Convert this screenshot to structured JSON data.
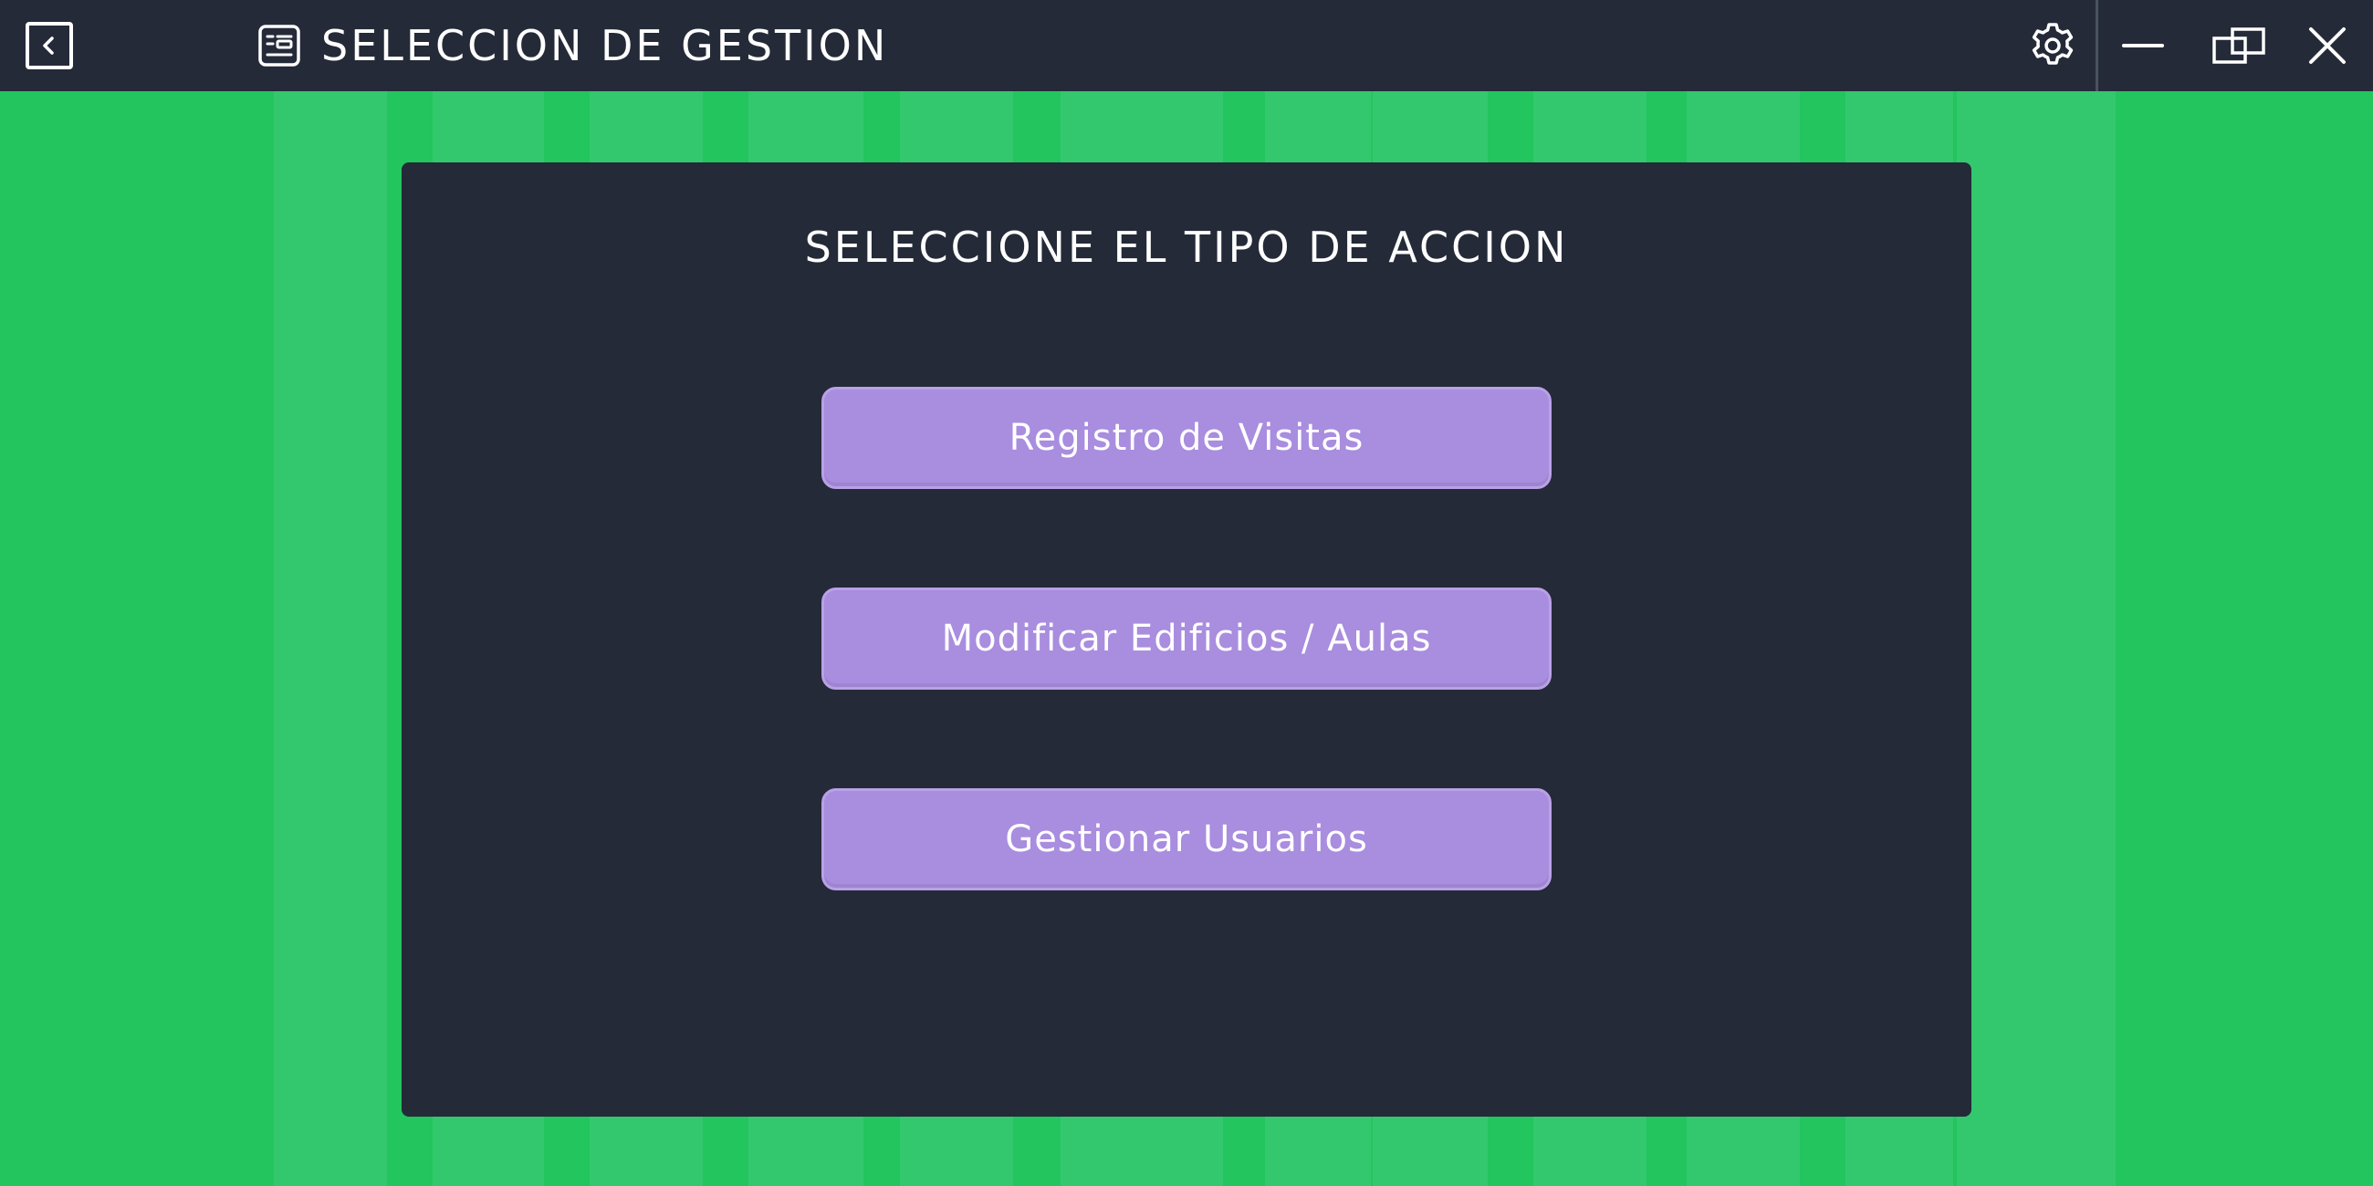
{
  "window": {
    "title": "SELECCION DE GESTION",
    "controls": {
      "back_icon": "chevron-left-icon",
      "app_icon": "form-list-icon",
      "settings_icon": "gear-icon",
      "minimize_icon": "minimize-icon",
      "restore_icon": "restore-icon",
      "close_icon": "close-icon"
    }
  },
  "card": {
    "title": "SELECCIONE EL TIPO DE ACCION",
    "buttons": [
      {
        "label": "Registro de Visitas"
      },
      {
        "label": "Modificar Edificios / Aulas"
      },
      {
        "label": "Gestionar Usuarios"
      }
    ]
  },
  "colors": {
    "titlebar": "#242a38",
    "background_green": "#22c55e",
    "stripe_green": "#34c86e",
    "card": "#242a38",
    "button": "#a98ddf",
    "text": "#ffffff"
  }
}
